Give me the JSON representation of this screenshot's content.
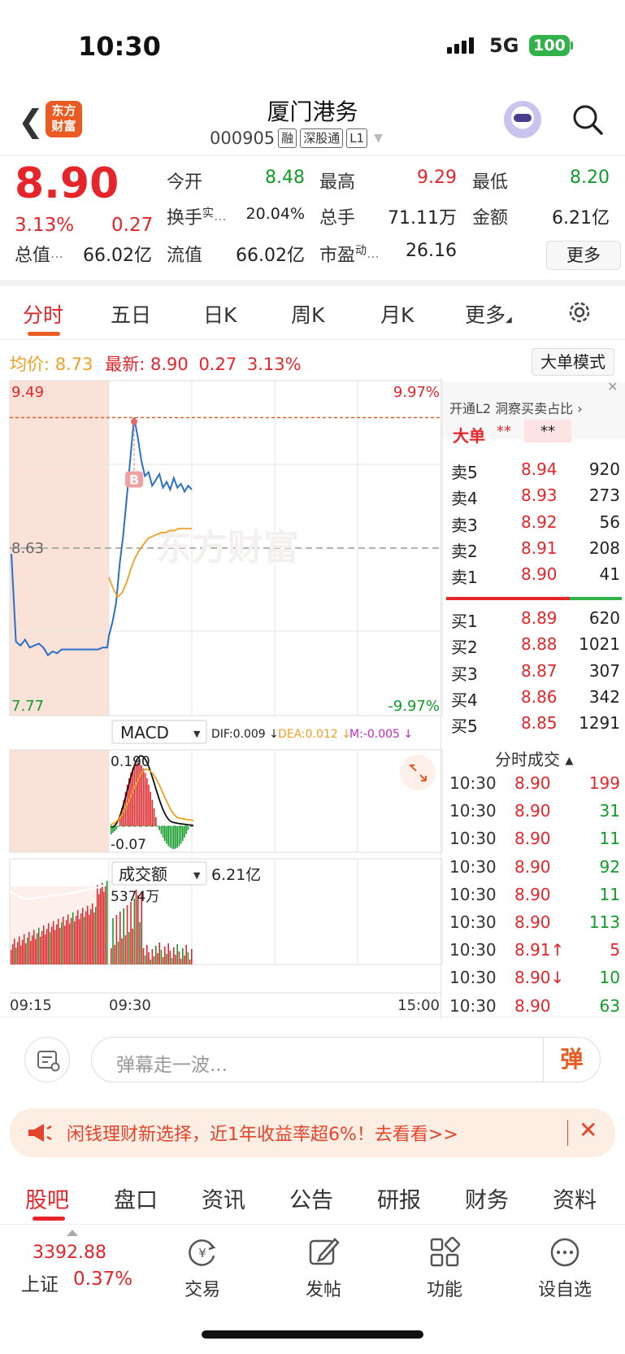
{
  "status_bar": {
    "time": "10:30",
    "network": "5G",
    "battery": "100"
  },
  "header": {
    "logo_line1": "东方",
    "logo_line2": "财富",
    "stock_name": "厦门港务",
    "code": "000905",
    "tags": [
      "融",
      "深股通",
      "L1"
    ]
  },
  "quote": {
    "price": "8.90",
    "change_pct": "3.13%",
    "change": "0.27",
    "stats": [
      {
        "label": "今开",
        "value": "8.48",
        "color": "green"
      },
      {
        "label": "最高",
        "value": "9.29",
        "color": "red"
      },
      {
        "label": "最低",
        "value": "8.20",
        "color": "green"
      },
      {
        "label": "换手",
        "sup": "实",
        "value": "20.04%",
        "color": "black"
      },
      {
        "label": "总手",
        "value": "71.11万",
        "color": "black"
      },
      {
        "label": "金额",
        "value": "6.21亿",
        "color": "black"
      },
      {
        "label": "总值",
        "value": "66.02亿",
        "color": "black"
      },
      {
        "label": "流值",
        "value": "66.02亿",
        "color": "black"
      },
      {
        "label": "市盈",
        "sup": "动",
        "value": "26.16",
        "color": "black"
      }
    ],
    "more_button": "更多"
  },
  "tabs": [
    "分时",
    "五日",
    "日K",
    "周K",
    "月K",
    "更多"
  ],
  "avg_line": {
    "avg_label": "均价:",
    "avg_value": "8.73",
    "latest_label": "最新:",
    "latest_value": "8.90",
    "change": "0.27",
    "pct": "3.13%"
  },
  "big_order_button": "大单模式",
  "chart_data": {
    "type": "line",
    "title": "",
    "y_top_label": "9.49",
    "y_mid_label": "8.63",
    "y_bottom_label": "7.77",
    "right_top_label": "9.97%",
    "right_bottom_label": "-9.97%",
    "ylim": [
      7.77,
      9.49
    ],
    "x_labels": [
      "09:15",
      "09:30",
      "15:00"
    ],
    "marker_label": "B",
    "watermark": "东方财富",
    "price_series": [
      8.6,
      8.15,
      8.13,
      8.16,
      8.12,
      8.13,
      8.14,
      8.12,
      8.08,
      8.1,
      8.09,
      8.11,
      8.11,
      8.11,
      8.11,
      8.11,
      8.11,
      8.11,
      8.11,
      8.11,
      8.12,
      8.12,
      8.18,
      8.25,
      8.35,
      8.55,
      8.7,
      8.9,
      9.1,
      9.3,
      9.2,
      9.08,
      9.0,
      9.02,
      8.95,
      8.98,
      9.01,
      8.94,
      8.97,
      8.93,
      8.99,
      8.94,
      8.96,
      8.92,
      8.95,
      8.93
    ],
    "avg_series": [
      8.48,
      8.42,
      8.38,
      8.4,
      8.45,
      8.52,
      8.58,
      8.62,
      8.65,
      8.68,
      8.69,
      8.7,
      8.71,
      8.71,
      8.72,
      8.72,
      8.73,
      8.73,
      8.73,
      8.73
    ],
    "macd": {
      "label": "MACD",
      "dif": "DIF:0.009",
      "dea": "DEA:0.012",
      "m": "M:-0.005",
      "top": "0.190",
      "bottom": "-0.07"
    },
    "volume": {
      "label": "成交额",
      "total": "6.21亿",
      "max_label": "5374万"
    }
  },
  "orderbook": {
    "l2_banner": "开通L2 洞察买卖占比",
    "big_label": "大单",
    "big_value1": "**",
    "big_value2": "**",
    "sells": [
      {
        "label": "卖5",
        "price": "8.94",
        "vol": "920"
      },
      {
        "label": "卖4",
        "price": "8.93",
        "vol": "273"
      },
      {
        "label": "卖3",
        "price": "8.92",
        "vol": "56"
      },
      {
        "label": "卖2",
        "price": "8.91",
        "vol": "208"
      },
      {
        "label": "卖1",
        "price": "8.90",
        "vol": "41"
      }
    ],
    "buys": [
      {
        "label": "买1",
        "price": "8.89",
        "vol": "620"
      },
      {
        "label": "买2",
        "price": "8.88",
        "vol": "1021"
      },
      {
        "label": "买3",
        "price": "8.87",
        "vol": "307"
      },
      {
        "label": "买4",
        "price": "8.86",
        "vol": "342"
      },
      {
        "label": "买5",
        "price": "8.85",
        "vol": "1291"
      }
    ],
    "trades_title": "分时成交",
    "trades": [
      {
        "time": "10:30",
        "price": "8.90",
        "vol": "199",
        "dir": "buy"
      },
      {
        "time": "10:30",
        "price": "8.90",
        "vol": "31",
        "dir": "sell"
      },
      {
        "time": "10:30",
        "price": "8.90",
        "vol": "11",
        "dir": "sell"
      },
      {
        "time": "10:30",
        "price": "8.90",
        "vol": "92",
        "dir": "sell"
      },
      {
        "time": "10:30",
        "price": "8.90",
        "vol": "11",
        "dir": "sell"
      },
      {
        "time": "10:30",
        "price": "8.90",
        "vol": "113",
        "dir": "sell"
      },
      {
        "time": "10:30",
        "price": "8.91↑",
        "vol": "5",
        "dir": "buy"
      },
      {
        "time": "10:30",
        "price": "8.90↓",
        "vol": "10",
        "dir": "sell"
      },
      {
        "time": "10:30",
        "price": "8.90",
        "vol": "63",
        "dir": "sell"
      }
    ]
  },
  "danmu": {
    "placeholder": "弹幕走一波...",
    "button": "弹"
  },
  "ad": {
    "text": "闲钱理财新选择，近1年收益率超6%！去看看>>",
    "close": "✕"
  },
  "bottom_tabs": [
    "股吧",
    "盘口",
    "资讯",
    "公告",
    "研报",
    "财务",
    "资料"
  ],
  "bottom_bar": {
    "index_value": "3392.88",
    "index_name": "上证",
    "index_pct": "0.37%",
    "items": [
      "交易",
      "发帖",
      "功能",
      "设自选"
    ]
  }
}
